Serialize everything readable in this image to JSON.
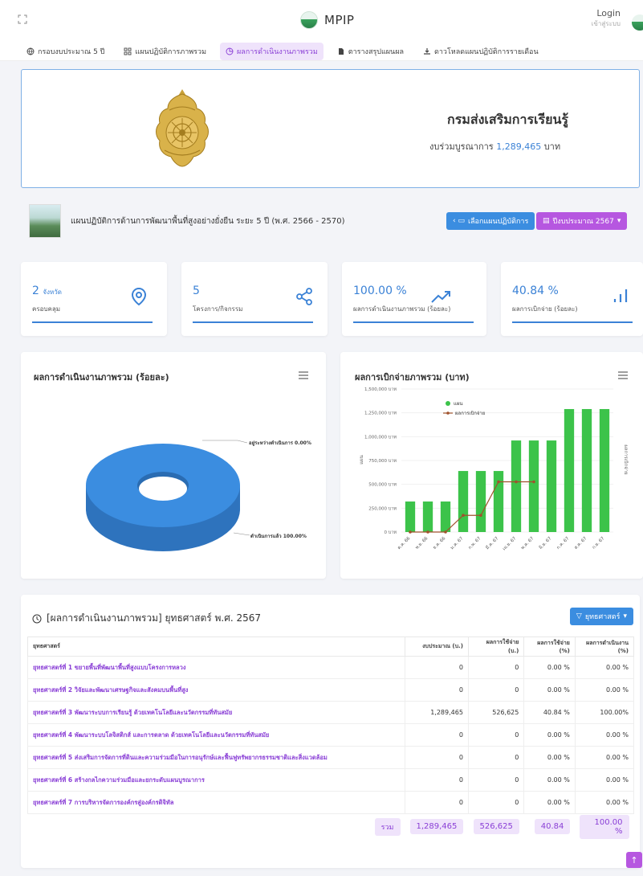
{
  "app": {
    "title": "MPIP"
  },
  "login": {
    "title": "Login",
    "subtitle": "เข้าสู่ระบบ"
  },
  "nav": {
    "items": [
      {
        "label": "กรอบงบประมาณ 5 ปี",
        "icon": "globe-icon",
        "active": false
      },
      {
        "label": "แผนปฏิบัติการภาพรวม",
        "icon": "grid-icon",
        "active": false
      },
      {
        "label": "ผลการดำเนินงานภาพรวม",
        "icon": "pie-icon",
        "active": true
      },
      {
        "label": "ตารางสรุปแผนผล",
        "icon": "document-icon",
        "active": false
      },
      {
        "label": "ดาวโหลดแผนปฏิบัติการรายเดือน",
        "icon": "download-icon",
        "active": false
      }
    ]
  },
  "hero": {
    "title": "กรมส่งเสริมการเรียนรู้",
    "budget_prefix": "งบร่วมบูรณาการ",
    "budget_value": "1,289,465",
    "budget_unit": "บาท"
  },
  "plan": {
    "title": "แผนปฏิบัติการด้านการพัฒนาพื้นที่สูงอย่างยั่งยืน ระยะ 5 ปี (พ.ศ. 2566 - 2570)",
    "select_button": "เลือกแผนปฏิบัติการ",
    "year_button": "ปีงบประมาณ 2567"
  },
  "stats": [
    {
      "value": "2",
      "unit": "จังหวัด",
      "label": "ครอบคลุม",
      "icon": "location-pin-icon"
    },
    {
      "value": "5",
      "unit": "",
      "label": "โครงการ/กิจกรรม",
      "icon": "share-icon"
    },
    {
      "value": "100.00 %",
      "unit": "",
      "label": "ผลการดำเนินงานภาพรวม (ร้อยละ)",
      "icon": "trending-up-icon"
    },
    {
      "value": "40.84 %",
      "unit": "",
      "label": "ผลการเบิกจ่าย (ร้อยละ)",
      "icon": "bar-chart-icon"
    }
  ],
  "colors": {
    "accent_blue": "#3b82d6",
    "accent_purple": "#8a3fd6",
    "bar_green": "#3cc34a",
    "line_brown": "#a0522d"
  },
  "pie_panel": {
    "title": "ผลการดำเนินงานภาพรวม (ร้อยละ)",
    "chart_data": {
      "type": "pie",
      "title": "ผลการดำเนินงานภาพรวม (ร้อยละ)",
      "slices": [
        {
          "label": "อยู่ระหว่างดำเนินการ",
          "value": 0.0,
          "display": "อยู่ระหว่างดำเนินการ 0.00%"
        },
        {
          "label": "ดำเนินการแล้ว",
          "value": 100.0,
          "display": "ดำเนินการแล้ว 100.00%"
        }
      ],
      "color": "#3b8de0"
    }
  },
  "bar_panel": {
    "title": "ผลการเบิกจ่ายภาพรวม (บาท)",
    "chart_data": {
      "type": "bar",
      "title": "ผลการเบิกจ่ายภาพรวม (บาท)",
      "categories": [
        "ต.ค. 66",
        "พ.ย. 66",
        "ธ.ค. 66",
        "ม.ค. 67",
        "ก.พ. 67",
        "มี.ค. 67",
        "เม.ย. 67",
        "พ.ค. 67",
        "มิ.ย. 67",
        "ก.ค. 67",
        "ส.ค. 67",
        "ก.ย. 67"
      ],
      "ylabel": "แผน",
      "ylabel_right": "ผลการเบิกจ่าย",
      "ylim": [
        0,
        1500000
      ],
      "yticks": [
        "0 บาท",
        "250,000 บาท",
        "500,000 บาท",
        "750,000 บาท",
        "1,000,000 บาท",
        "1,250,000 บาท",
        "1,500,000 บาท"
      ],
      "series": [
        {
          "name": "แผน",
          "type": "bar",
          "color": "#3cc34a",
          "values": [
            320000,
            320000,
            320000,
            640000,
            640000,
            640000,
            960000,
            960000,
            960000,
            1289465,
            1289465,
            1289465
          ]
        },
        {
          "name": "ผลการเบิกจ่าย",
          "type": "line",
          "color": "#a0522d",
          "values": [
            0,
            0,
            0,
            175000,
            175000,
            526625,
            526625,
            526625,
            null,
            null,
            null,
            null
          ]
        }
      ],
      "legend": "top-left"
    }
  },
  "table": {
    "title": "[ผลการดำเนินงานภาพรวม] ยุทธศาสตร์ พ.ศ. 2567",
    "filter_button": "ยุทธศาสตร์",
    "headers": [
      "ยุทธศาสตร์",
      "งบประมาณ (บ.)",
      "ผลการใช้จ่าย (บ.)",
      "ผลการใช้จ่าย (%)",
      "ผลการดำเนินงาน (%)"
    ],
    "rows": [
      [
        "ยุทธศาสตร์ที่ 1 ขยายพื้นที่พัฒนาพื้นที่สูงแบบโครงการหลวง",
        "0",
        "0",
        "0.00 %",
        "0.00 %"
      ],
      [
        "ยุทธศาสตร์ที่ 2 วิจัยและพัฒนาเศรษฐกิจและสังคมบนพื้นที่สูง",
        "0",
        "0",
        "0.00 %",
        "0.00 %"
      ],
      [
        "ยุทธศาสตร์ที่ 3 พัฒนาระบบการเรียนรู้ ด้วยเทคโนโลยีและนวัตกรรมที่ทันสมัย",
        "1,289,465",
        "526,625",
        "40.84 %",
        "100.00%"
      ],
      [
        "ยุทธศาสตร์ที่ 4 พัฒนาระบบโลจิสติกส์ และการตลาด ด้วยเทคโนโลยีและนวัตกรรมที่ทันสมัย",
        "0",
        "0",
        "0.00 %",
        "0.00 %"
      ],
      [
        "ยุทธศาสตร์ที่ 5 ส่งเสริมการจัดการที่ดินและความร่วมมือในการอนุรักษ์และฟื้นฟูทรัพยากรธรรมชาติและสิ่งแวดล้อม",
        "0",
        "0",
        "0.00 %",
        "0.00 %"
      ],
      [
        "ยุทธศาสตร์ที่ 6 สร้างกลไกความร่วมมือและยกระดับแผนบูรณาการ",
        "0",
        "0",
        "0.00 %",
        "0.00 %"
      ],
      [
        "ยุทธศาสตร์ที่ 7 การบริหารจัดการองค์กรสู่องค์กรดิจิทัล",
        "0",
        "0",
        "0.00 %",
        "0.00 %"
      ]
    ],
    "total": {
      "label": "รวม",
      "budget": "1,289,465",
      "spent": "526,625",
      "spent_pct": "40.84",
      "perf_pct": "100.00 %"
    }
  },
  "scroll_top": {
    "label": "↑"
  }
}
